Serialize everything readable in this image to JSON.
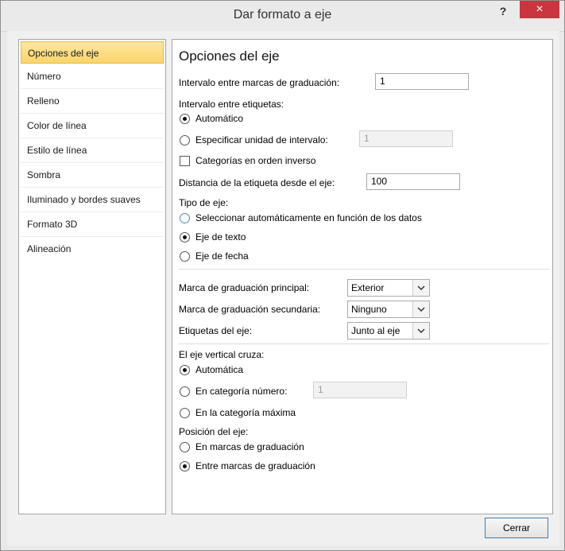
{
  "window": {
    "title": "Dar formato a eje",
    "help_label": "?",
    "close_label": "×"
  },
  "nav": {
    "items": [
      {
        "label": "Opciones del eje"
      },
      {
        "label": "Número"
      },
      {
        "label": "Relleno"
      },
      {
        "label": "Color de línea"
      },
      {
        "label": "Estilo de línea"
      },
      {
        "label": "Sombra"
      },
      {
        "label": "Iluminado y bordes suaves"
      },
      {
        "label": "Formato 3D"
      },
      {
        "label": "Alineación"
      }
    ],
    "selected_index": 0
  },
  "panel": {
    "title": "Opciones del eje",
    "interval_marks": {
      "label": "Intervalo entre marcas de graduación:",
      "value": "1"
    },
    "label_interval": {
      "heading": "Intervalo entre etiquetas:",
      "auto_label": "Automático",
      "auto_selected": true,
      "specify_label": "Especificar unidad de intervalo:",
      "specify_value": "1"
    },
    "reverse_order": {
      "label": "Categorías en orden inverso",
      "checked": false
    },
    "label_distance": {
      "label": "Distancia de la etiqueta desde el eje:",
      "value": "100"
    },
    "axis_type": {
      "heading": "Tipo de eje:",
      "options": [
        {
          "label": "Seleccionar automáticamente en función de los datos",
          "checked": false
        },
        {
          "label": "Eje de texto",
          "checked": true
        },
        {
          "label": "Eje de fecha",
          "checked": false
        }
      ]
    },
    "major_tick": {
      "label": "Marca de graduación principal:",
      "value": "Exterior"
    },
    "minor_tick": {
      "label": "Marca de graduación secundaria:",
      "value": "Ninguno"
    },
    "axis_labels": {
      "label": "Etiquetas del eje:",
      "value": "Junto al eje"
    },
    "vertical_cross": {
      "heading": "El eje vertical cruza:",
      "auto_label": "Automática",
      "category_number_label": "En categoría número:",
      "category_number_value": "1",
      "max_category_label": "En la categoría máxima",
      "selected": "auto"
    },
    "axis_position": {
      "heading": "Posición del eje:",
      "on_marks_label": "En marcas de graduación",
      "between_marks_label": "Entre marcas de graduación",
      "selected": "between"
    }
  },
  "footer": {
    "close_button": "Cerrar"
  }
}
